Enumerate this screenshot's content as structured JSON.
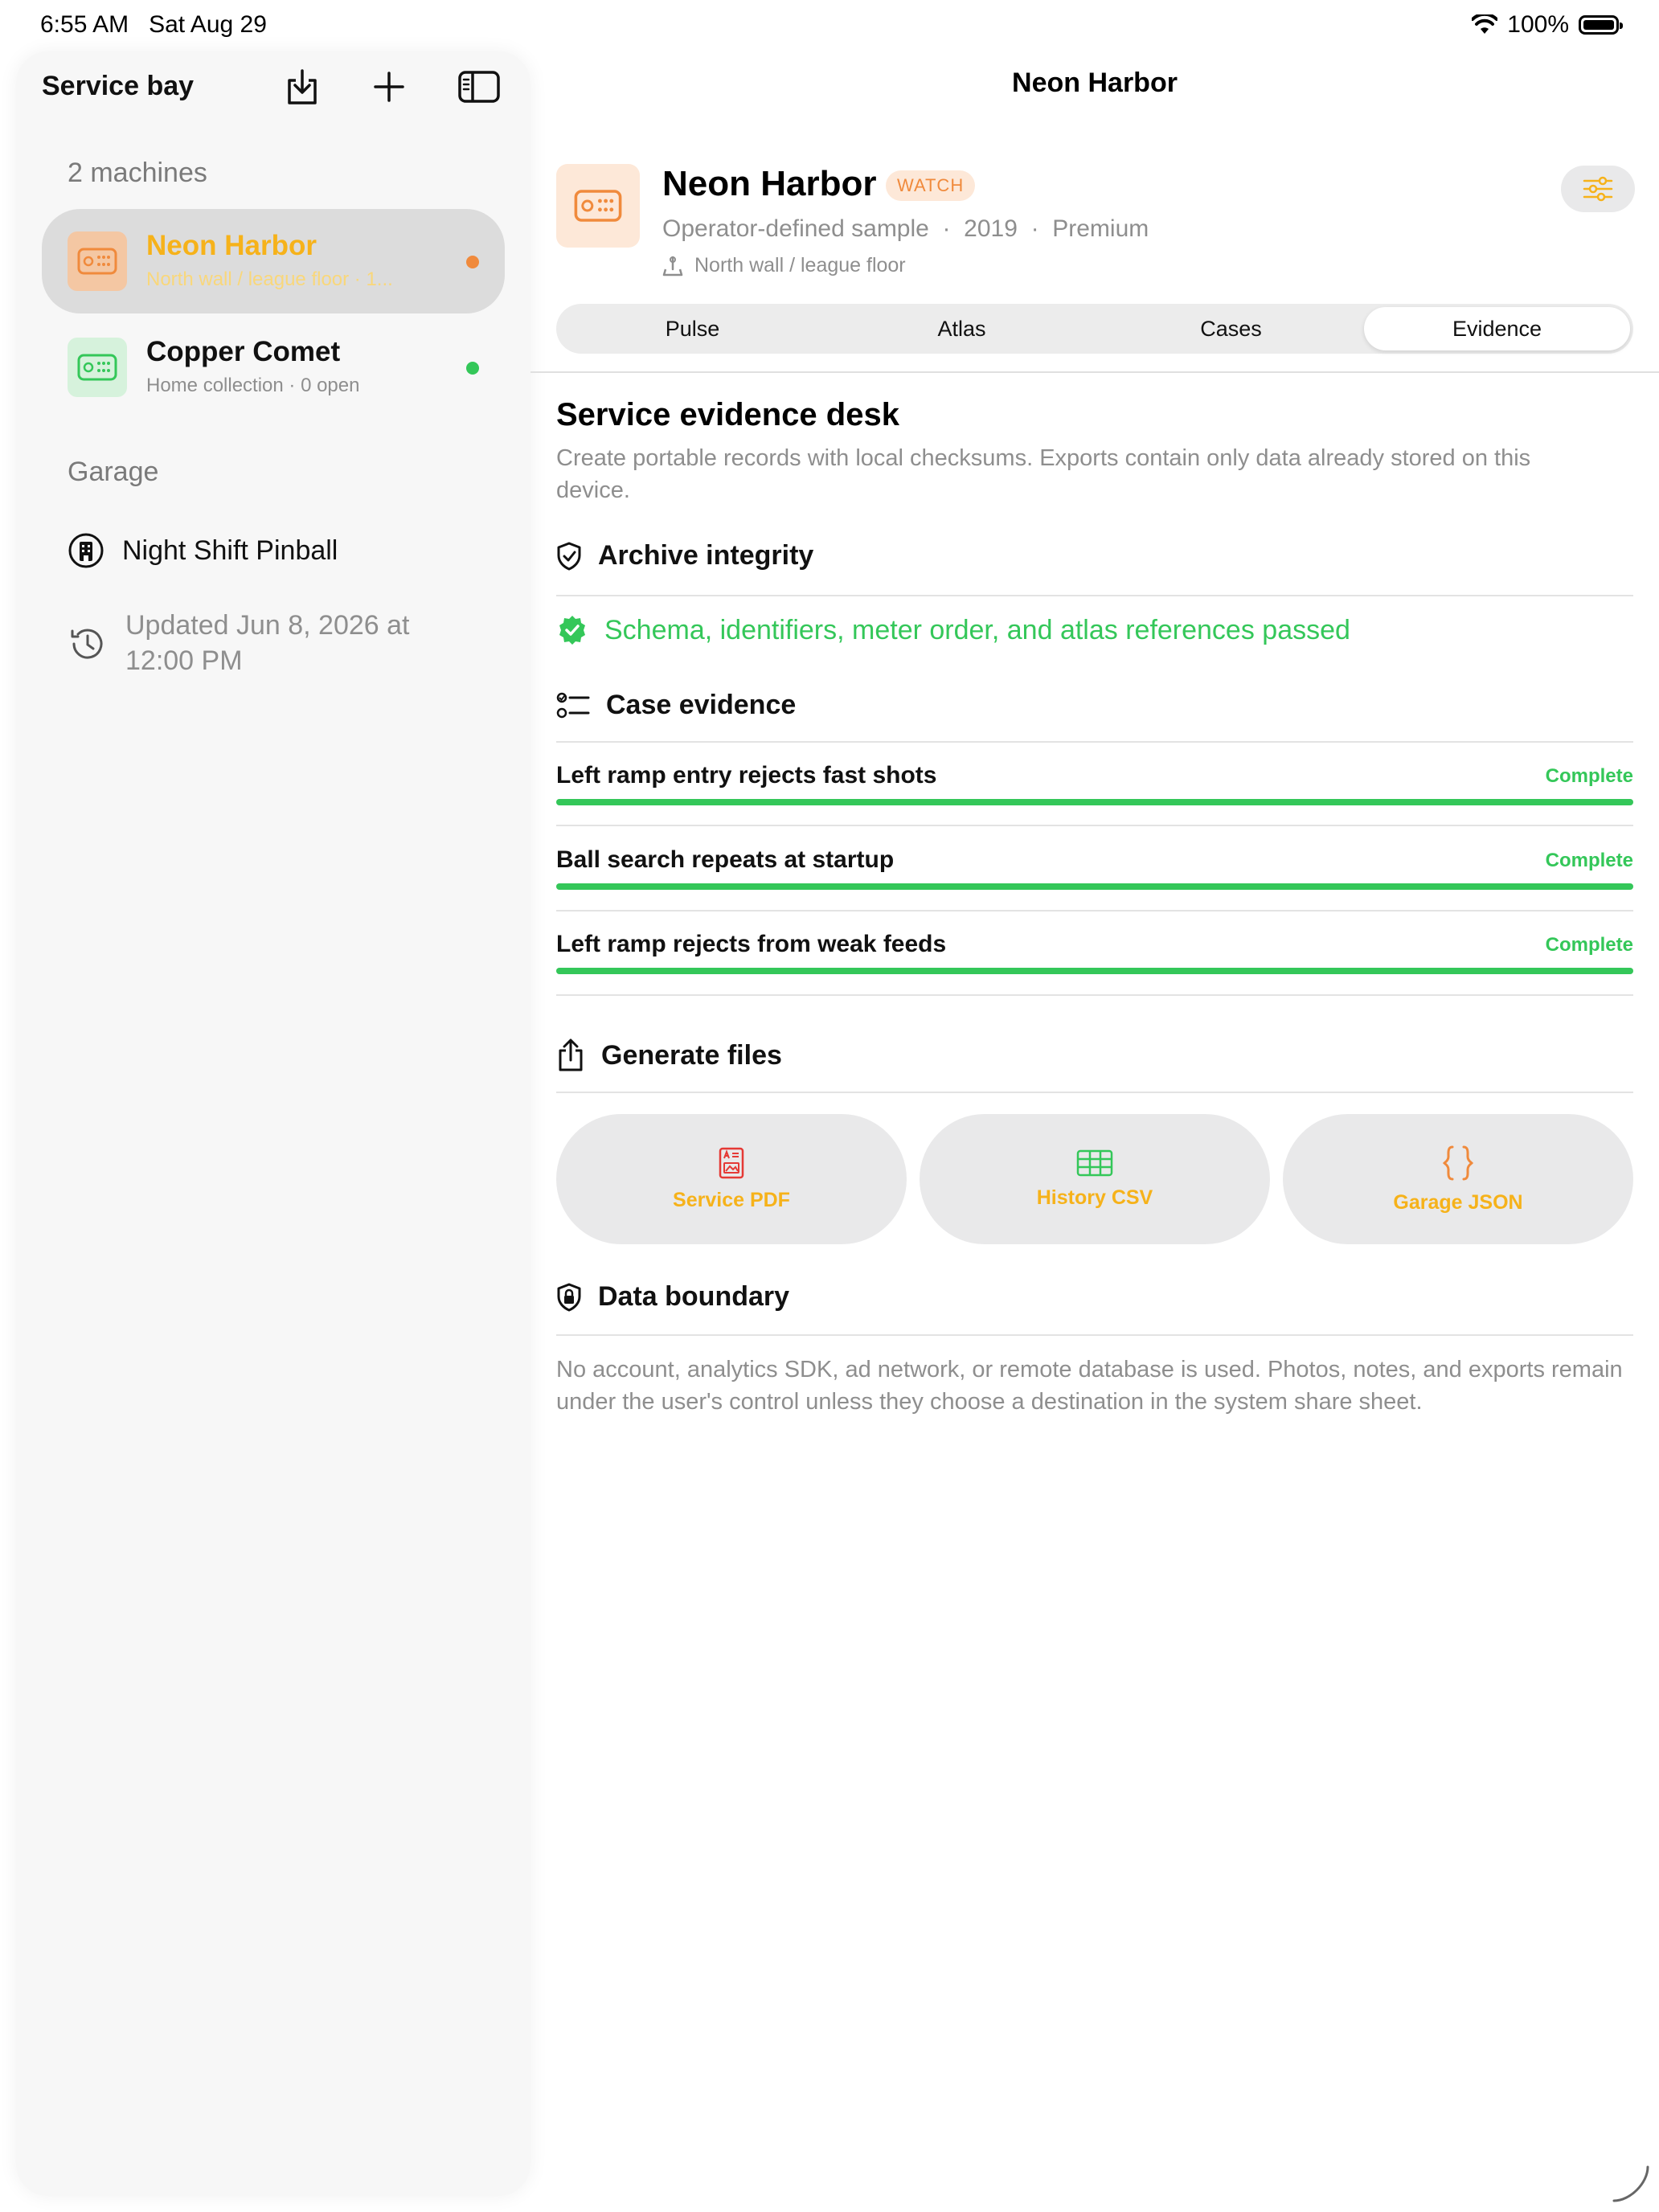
{
  "status_bar": {
    "time": "6:55 AM",
    "date": "Sat Aug 29",
    "battery": "100%"
  },
  "sidebar": {
    "title": "Service bay",
    "machines_heading": "2 machines",
    "machines": [
      {
        "name": "Neon Harbor",
        "subtitle": "North wall / league floor  ·  1...",
        "selected": true,
        "accent": "#f08a3c",
        "name_color": "#f6b21a"
      },
      {
        "name": "Copper Comet",
        "subtitle": "Home collection  ·  0 open",
        "selected": false,
        "accent": "#34c759",
        "name_color": "#111111"
      }
    ],
    "garage_heading": "Garage",
    "garage_name": "Night Shift Pinball",
    "updated": "Updated Jun 8, 2026 at 12:00 PM"
  },
  "nav": {
    "title": "Neon Harbor"
  },
  "header": {
    "name": "Neon Harbor",
    "badge": "WATCH",
    "meta": "Operator-defined sample  ·  2019  ·  Premium",
    "location": "North wall / league floor"
  },
  "tabs": [
    {
      "label": "Pulse",
      "active": false
    },
    {
      "label": "Atlas",
      "active": false
    },
    {
      "label": "Cases",
      "active": false
    },
    {
      "label": "Evidence",
      "active": true
    }
  ],
  "evidence": {
    "title": "Service evidence desk",
    "description": "Create portable records with local checksums. Exports contain only data already stored on this device.",
    "integrity_heading": "Archive integrity",
    "integrity_status": "Schema, identifiers, meter order, and atlas references passed",
    "case_heading": "Case evidence",
    "cases": [
      {
        "title": "Left ramp entry rejects fast shots",
        "status": "Complete",
        "progress": 1.0
      },
      {
        "title": "Ball search repeats at startup",
        "status": "Complete",
        "progress": 1.0
      },
      {
        "title": "Left ramp rejects from weak feeds",
        "status": "Complete",
        "progress": 1.0
      }
    ],
    "generate_heading": "Generate files",
    "files": [
      {
        "label": "Service PDF",
        "icon": "pdf-doc-icon",
        "color": "#e53935"
      },
      {
        "label": "History CSV",
        "icon": "table-icon",
        "color": "#34c759"
      },
      {
        "label": "Garage JSON",
        "icon": "curly-braces-icon",
        "color": "#f08a3c"
      }
    ],
    "boundary_heading": "Data boundary",
    "boundary_text": "No account, analytics SDK, ad network, or remote database is used. Photos, notes, and exports remain under the user's control unless they choose a destination in the system share sheet."
  },
  "colors": {
    "accent_orange": "#f08a3c",
    "accent_yellow": "#f6b21a",
    "success_green": "#34c759",
    "secondary_text": "#8e8e8e"
  }
}
